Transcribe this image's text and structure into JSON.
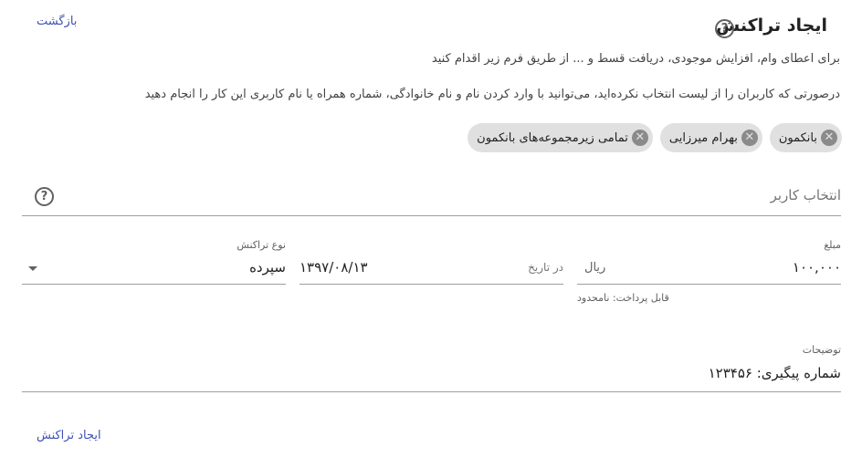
{
  "header": {
    "title": "ایجاد تراکنش",
    "help_icon": "?",
    "back_label": "بازگشت"
  },
  "descriptions": {
    "line1": "برای اعطای وام، افزایش موجودی، دریافت قسط و ... از طریق فرم زیر اقدام کنید",
    "line2": "درصورتی که کاربران را از لیست انتخاب نکرده‌اید، می‌توانید با وارد کردن نام و نام خانوادگی، شماره همراه یا نام کاربری این کار را انجام دهید"
  },
  "chips": [
    {
      "label": "بانکمون",
      "icon": "cancel-icon"
    },
    {
      "label": "بهرام میرزایی",
      "icon": "cancel-icon"
    },
    {
      "label": "تمامی زیرمجموعه‌های بانکمون",
      "icon": "cancel-icon"
    }
  ],
  "user_select": {
    "placeholder": "انتخاب کاربر",
    "help_icon": "?"
  },
  "amount": {
    "label": "مبلغ",
    "value": "۱۰۰,۰۰۰",
    "unit": "ریال",
    "hint": "قابل پرداخت: نامحدود"
  },
  "date": {
    "label": "در تاریخ",
    "value": "۱۳۹۷/۰۸/۱۳"
  },
  "transaction_type": {
    "label": "نوع تراکنش",
    "value": "سپرده"
  },
  "notes": {
    "label": "توضیحات",
    "value": "شماره پیگیری: ۱۲۳۴۵۶"
  },
  "actions": {
    "submit_label": "ایجاد تراکنش"
  }
}
